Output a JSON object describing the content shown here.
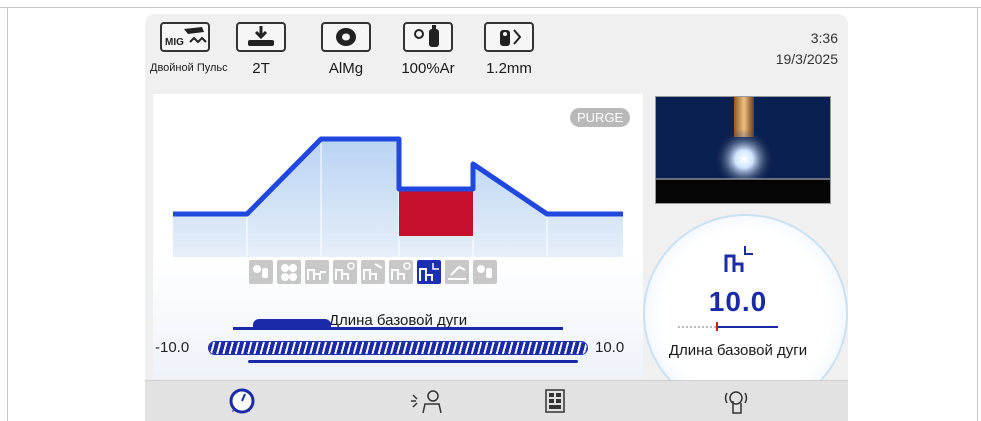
{
  "top_params": [
    {
      "icon": "mig-torch-icon",
      "badge": "MIG",
      "label": "Двойной Пульс"
    },
    {
      "icon": "trigger-mode-icon",
      "label": "2T"
    },
    {
      "icon": "wire-spool-icon",
      "label": "AlMg"
    },
    {
      "icon": "gas-cylinder-icon",
      "label": "100%Ar"
    },
    {
      "icon": "wire-diameter-icon",
      "label": "1.2mm"
    }
  ],
  "clock": {
    "time": "3:36",
    "date": "19/3/2025"
  },
  "main": {
    "purge_label": "PURGE",
    "parameter_label": "Длина базовой дуги",
    "scale_min": "-10.0",
    "scale_max": "10.0",
    "modes": [
      "gas-preflow-icon",
      "wire-inch-icon",
      "start-current-icon",
      "start-time-icon",
      "slope-icon",
      "pulse-time-icon",
      "base-arc-length-icon",
      "crater-icon",
      "gas-postflow-icon"
    ],
    "active_mode_index": 6
  },
  "dial": {
    "value": "10.0",
    "label": "Длина базовой дуги"
  },
  "nav": [
    "gauge-icon",
    "welder-icon",
    "menu-grid-icon",
    "touch-icon"
  ],
  "colors": {
    "accent": "#1a2aa8",
    "profile": "#2048e0",
    "highlight": "#c8102e"
  }
}
